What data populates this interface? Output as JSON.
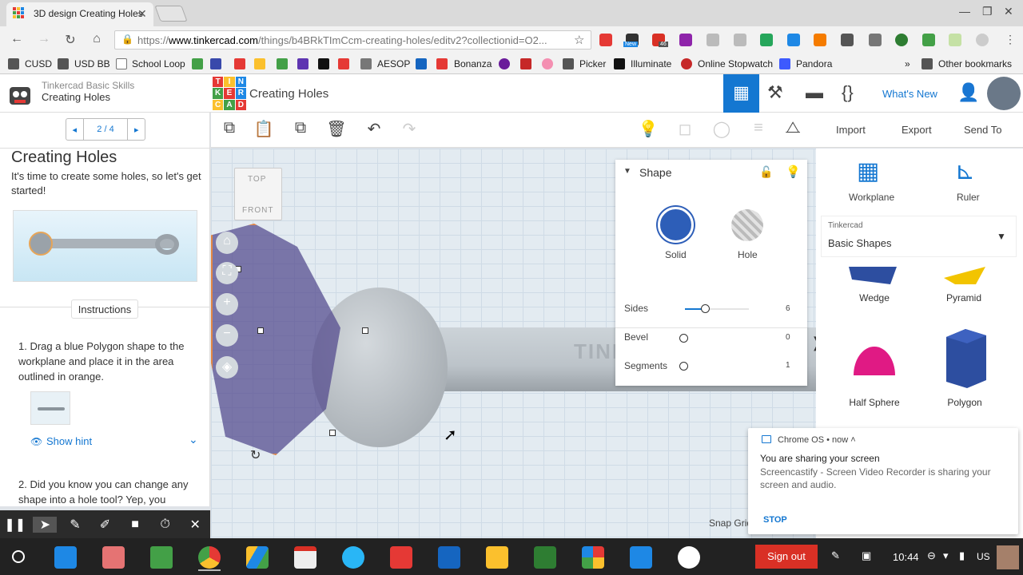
{
  "browser": {
    "tab_title": "3D design Creating Holes",
    "url_scheme": "https://",
    "url_host": "www.tinkercad.com",
    "url_rest": "/things/b4BRkTImCcm-creating-holes/editv2?collectionid=O2...",
    "bookmarks": [
      "CUSD",
      "USD BB",
      "School Loop",
      "AESOP",
      "Bonanza",
      "Picker",
      "Illuminate",
      "Online Stopwatch",
      "Pandora"
    ],
    "bookmarks_overflow": "»",
    "other_bookmarks": "Other bookmarks",
    "ext_badge_1": "New",
    "ext_badge_2": "46"
  },
  "lesson": {
    "subtitle": "Tinkercad Basic Skills",
    "title": "Creating Holes",
    "pager": "2 / 4",
    "heading": "Creating Holes",
    "intro": "It's time to create some holes, so let's get started!",
    "instructions_tab": "Instructions",
    "step1": "1. Drag a blue Polygon shape to the workplane and place it in the area outlined in orange.",
    "show_hint": "Show hint",
    "step2": "2. Did you know you can change any shape into a hole tool? Yep, you"
  },
  "app": {
    "logo_letters": [
      "TIN",
      "KER",
      "CAD"
    ],
    "design_title": "Creating Holes",
    "whats_new": "What's New",
    "import": "Import",
    "export": "Export",
    "send_to": "Send To",
    "snap_grid": "Snap Grid"
  },
  "viewcube": {
    "top": "TOP",
    "front": "FRONT"
  },
  "workplane": {
    "engraving": "TINKERCAD.CO"
  },
  "inspector": {
    "title": "Shape",
    "solid": "Solid",
    "hole": "Hole",
    "sides_label": "Sides",
    "sides_value": "6",
    "sides_level": 0.33,
    "bevel_label": "Bevel",
    "bevel_value": "0",
    "segments_label": "Segments",
    "segments_value": "1",
    "solid_color": "#2d5eb8"
  },
  "right_panel": {
    "workplane": "Workplane",
    "ruler": "Ruler",
    "library_source": "Tinkercad",
    "library_name": "Basic Shapes",
    "shapes": [
      "Wedge",
      "Pyramid",
      "Half Sphere",
      "Polygon"
    ]
  },
  "notification": {
    "source": "Chrome OS",
    "time": "now",
    "title": "You are sharing your screen",
    "body": "Screencastify - Screen Video Recorder is sharing your screen and audio.",
    "action": "STOP"
  },
  "shelf": {
    "sign_out": "Sign out",
    "time": "10:44",
    "locale": "US"
  },
  "colors": {
    "accent": "#1477d1",
    "signout": "#d93025",
    "hole_outline": "#ff8c2a"
  }
}
